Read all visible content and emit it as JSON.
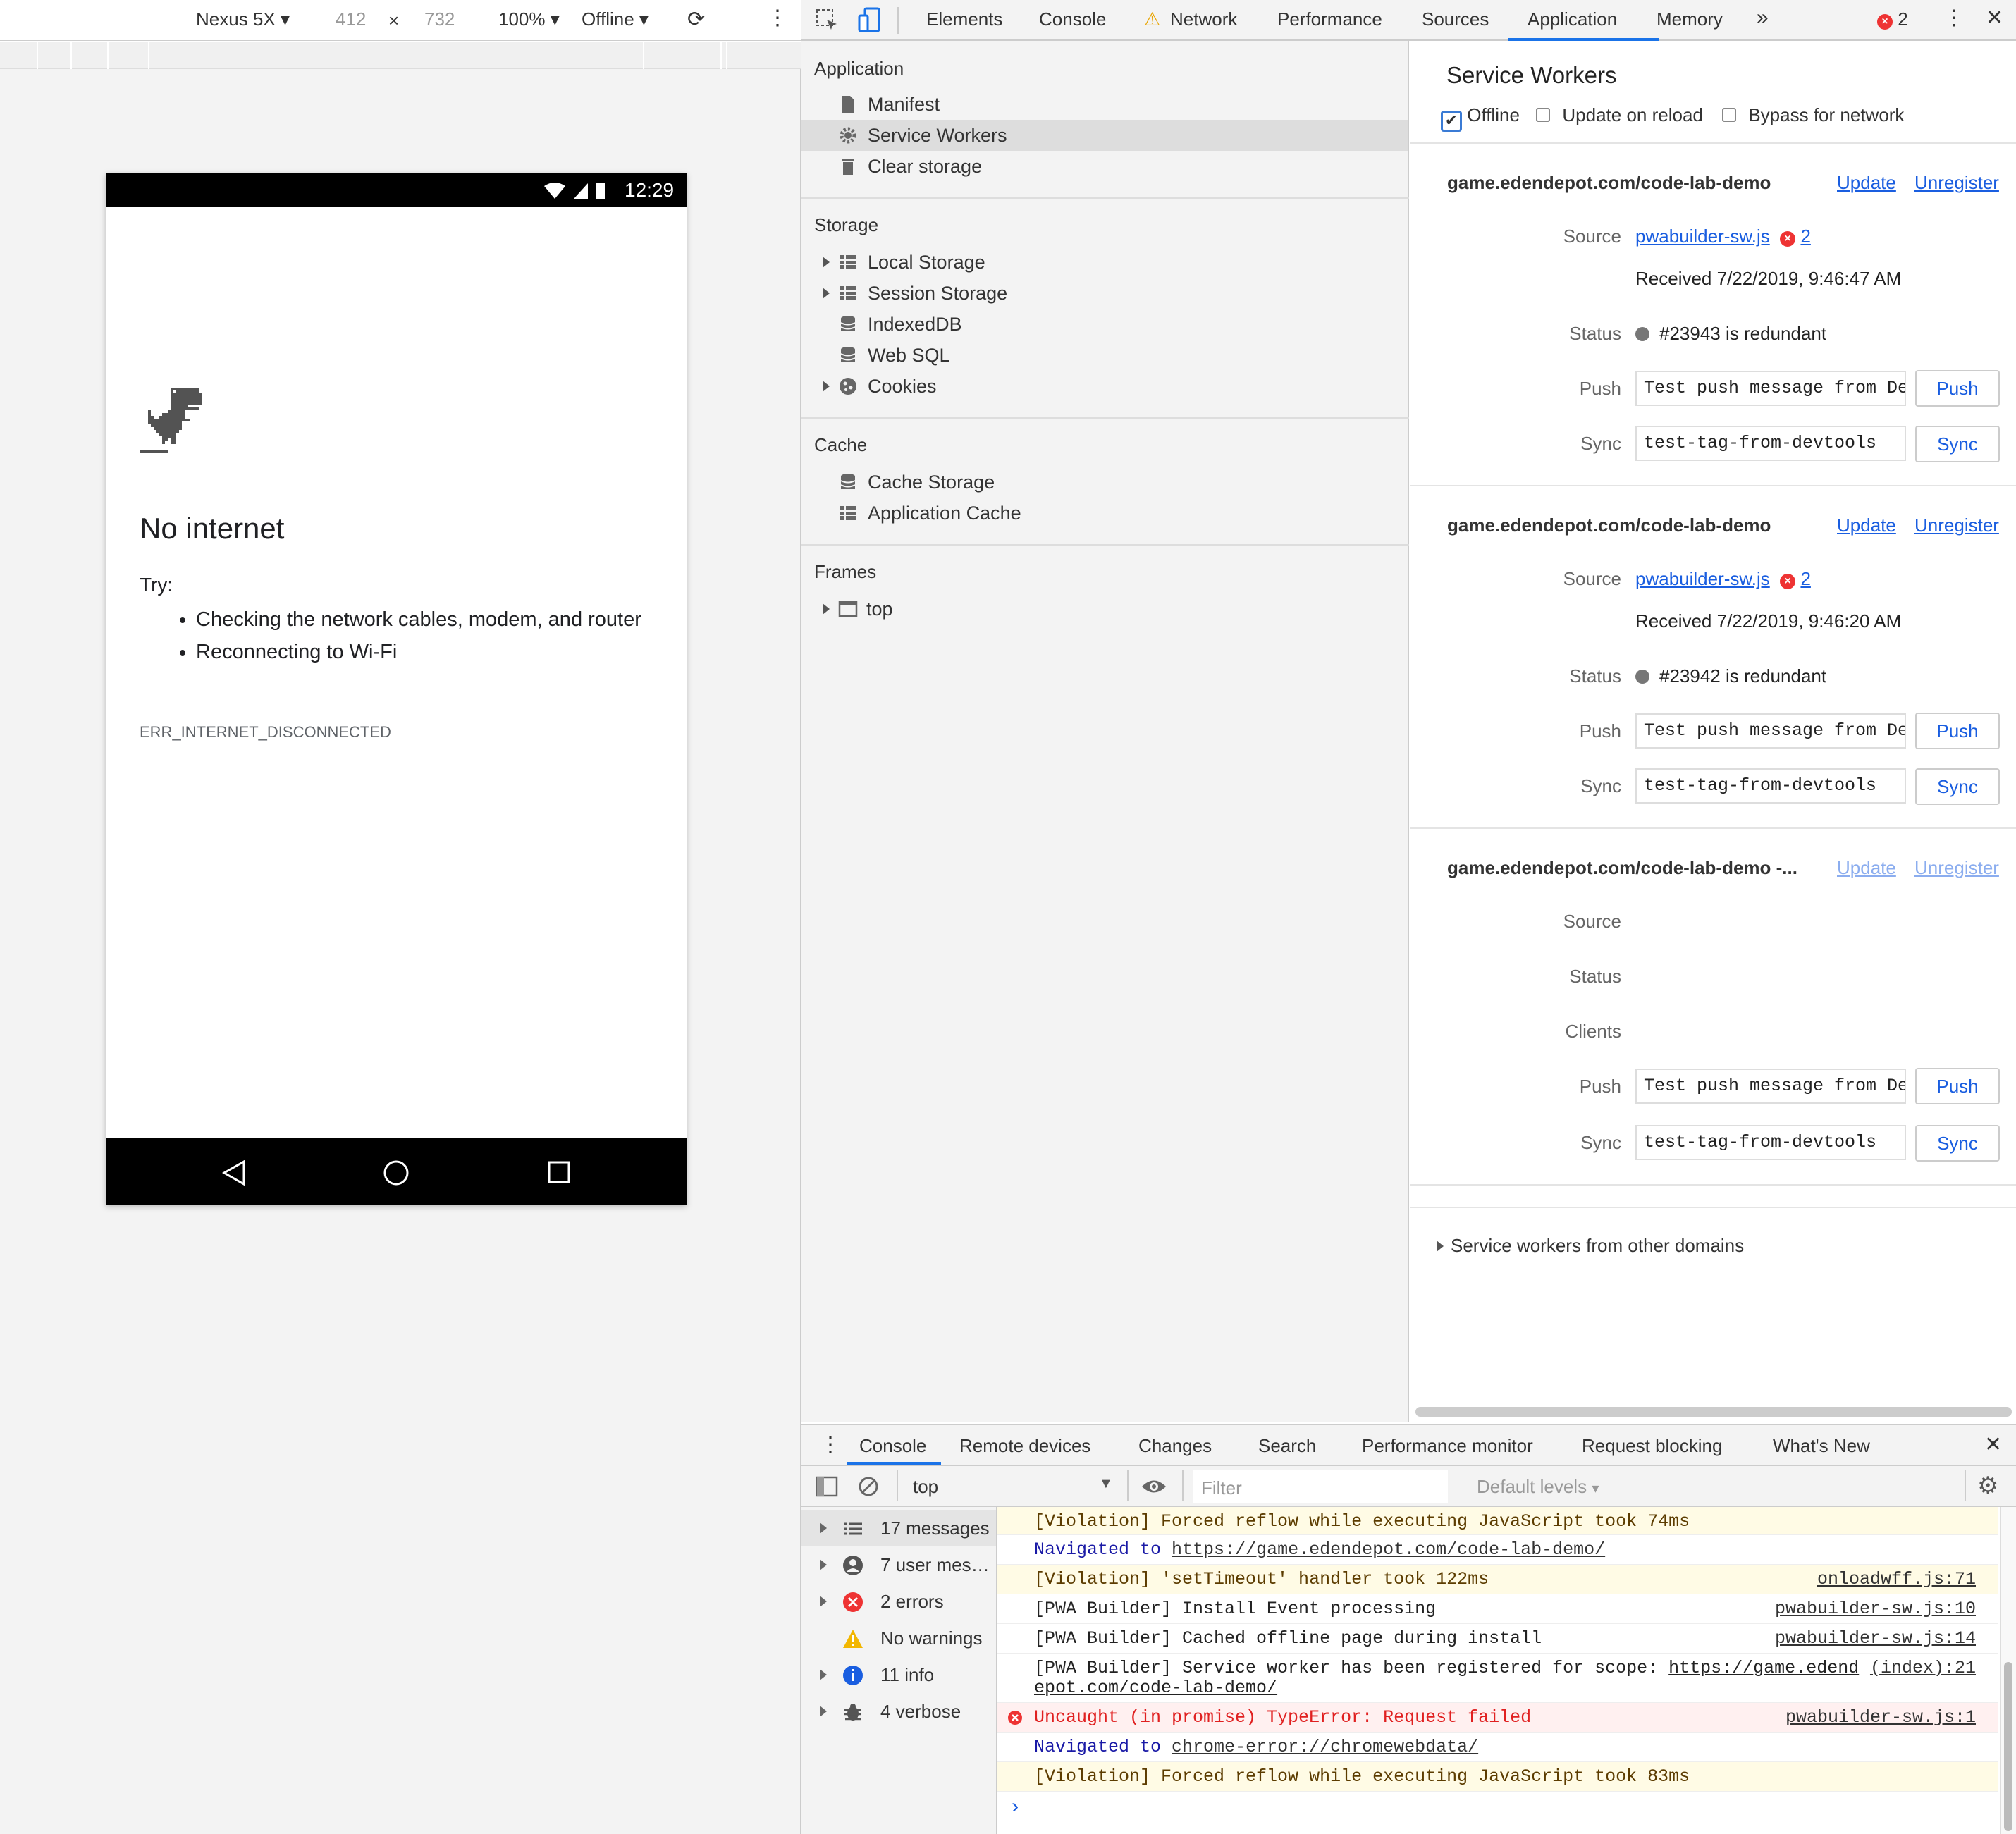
{
  "device_toolbar": {
    "device": "Nexus 5X",
    "width": "412",
    "height": "732",
    "zoom": "100%",
    "throttle": "Offline"
  },
  "phone": {
    "time": "12:29",
    "heading": "No internet",
    "try": "Try:",
    "bullets": [
      "Checking the network cables, modem, and router",
      "Reconnecting to Wi-Fi"
    ],
    "error_code": "ERR_INTERNET_DISCONNECTED"
  },
  "devtools_tabs": [
    "Elements",
    "Console",
    "Network",
    "Performance",
    "Sources",
    "Application",
    "Memory"
  ],
  "error_count": "2",
  "sidebar": {
    "app_head": "Application",
    "app_items": [
      "Manifest",
      "Service Workers",
      "Clear storage"
    ],
    "storage_head": "Storage",
    "storage_items": [
      "Local Storage",
      "Session Storage",
      "IndexedDB",
      "Web SQL",
      "Cookies"
    ],
    "cache_head": "Cache",
    "cache_items": [
      "Cache Storage",
      "Application Cache"
    ],
    "frames_head": "Frames",
    "frames_items": [
      "top"
    ]
  },
  "sw": {
    "title": "Service Workers",
    "opt_offline": "Offline",
    "opt_update": "Update on reload",
    "opt_bypass": "Bypass for network",
    "update_label": "Update",
    "unregister_label": "Unregister",
    "source_label": "Source",
    "status_label": "Status",
    "clients_label": "Clients",
    "push_label": "Push",
    "sync_label": "Sync",
    "push_btn": "Push",
    "sync_btn": "Sync",
    "workers": [
      {
        "origin": "game.edendepot.com/code-lab-demo",
        "source": "pwabuilder-sw.js",
        "errors": "2",
        "received": "Received 7/22/2019, 9:46:47 AM",
        "status": "#23943 is redundant",
        "push_value": "Test push message from DevTools.",
        "sync_value": "test-tag-from-devtools"
      },
      {
        "origin": "game.edendepot.com/code-lab-demo",
        "source": "pwabuilder-sw.js",
        "errors": "2",
        "received": "Received 7/22/2019, 9:46:20 AM",
        "status": "#23942 is redundant",
        "push_value": "Test push message from DevTools.",
        "sync_value": "test-tag-from-devtools"
      },
      {
        "origin": "game.edendepot.com/code-lab-demo -...",
        "push_value": "Test push message from DevTools.",
        "sync_value": "test-tag-from-devtools"
      }
    ],
    "other_domains": "Service workers from other domains"
  },
  "drawer_tabs": [
    "Console",
    "Remote devices",
    "Changes",
    "Search",
    "Performance monitor",
    "Request blocking",
    "What's New"
  ],
  "console": {
    "context": "top",
    "filter_placeholder": "Filter",
    "levels": "Default levels",
    "sidebar": [
      "17 messages",
      "7 user mes…",
      "2 errors",
      "No warnings",
      "11 info",
      "4 verbose"
    ],
    "messages": [
      {
        "text": "[Violation] Forced reflow while executing JavaScript took 74ms",
        "src": ""
      },
      {
        "text": "Navigated to ",
        "link": "https://game.edendepot.com/code-lab-demo/"
      },
      {
        "text": "[Violation] 'setTimeout' handler took 122ms",
        "src": "onloadwff.js:71"
      },
      {
        "text": "[PWA Builder] Install Event processing",
        "src": "pwabuilder-sw.js:10"
      },
      {
        "text": "[PWA Builder] Cached offline page during install",
        "src": "pwabuilder-sw.js:14"
      },
      {
        "text": "[PWA Builder] Service worker has been registered for scope: ",
        "link": "https://game.edend",
        "link2": "epot.com/code-lab-demo/",
        "src": "(index):21"
      },
      {
        "text": "Uncaught (in promise) TypeError: Request failed",
        "src": "pwabuilder-sw.js:1"
      },
      {
        "text": "Navigated to ",
        "link": "chrome-error://chromewebdata/"
      },
      {
        "text": "[Violation] Forced reflow while executing JavaScript took 83ms",
        "src": ""
      }
    ],
    "prompt": "›"
  }
}
